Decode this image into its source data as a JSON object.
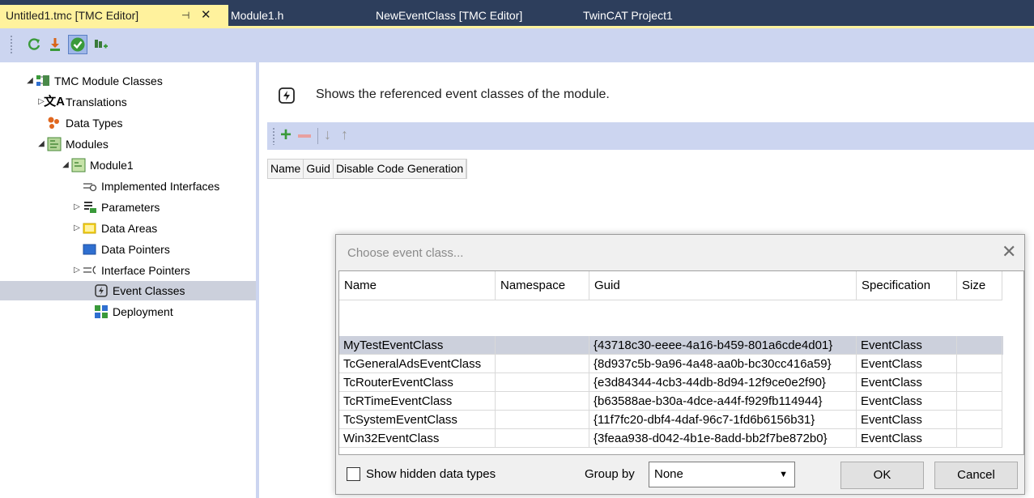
{
  "tabs": [
    {
      "label": "Untitled1.tmc [TMC Editor]",
      "active": true
    },
    {
      "label": "Module1.h"
    },
    {
      "label": "NewEventClass [TMC Editor]"
    },
    {
      "label": "TwinCAT Project1"
    }
  ],
  "tab_pin": "⊣",
  "tab_close": "✕",
  "toolbar_icons": [
    "refresh-icon",
    "download-icon",
    "check-icon",
    "plugin-icon"
  ],
  "tree": [
    {
      "label": "TMC Module Classes",
      "expander": "◢",
      "icon": "module-classes-icon"
    },
    {
      "label": "Translations",
      "expander": "▷",
      "icon": "translations-icon"
    },
    {
      "label": "Data Types",
      "expander": "",
      "icon": "data-types-icon"
    },
    {
      "label": "Modules",
      "expander": "◢",
      "icon": "modules-icon"
    },
    {
      "label": "Module1",
      "expander": "◢",
      "icon": "module-icon"
    },
    {
      "label": "Implemented Interfaces",
      "expander": "",
      "icon": "interfaces-icon"
    },
    {
      "label": "Parameters",
      "expander": "▷",
      "icon": "parameters-icon"
    },
    {
      "label": "Data Areas",
      "expander": "▷",
      "icon": "data-areas-icon"
    },
    {
      "label": "Data Pointers",
      "expander": "",
      "icon": "data-pointers-icon"
    },
    {
      "label": "Interface Pointers",
      "expander": "▷",
      "icon": "interface-pointers-icon"
    },
    {
      "label": "Event Classes",
      "expander": "",
      "icon": "event-classes-icon",
      "selected": true
    },
    {
      "label": "Deployment",
      "expander": "",
      "icon": "deployment-icon"
    }
  ],
  "description": "Shows the referenced event classes of the module.",
  "grid_columns": [
    "Name",
    "Guid",
    "Disable Code Generation"
  ],
  "dialog": {
    "title": "Choose event class...",
    "close": "✕",
    "columns": [
      "Name",
      "Namespace",
      "Guid",
      "Specification",
      "Size"
    ],
    "rows": [
      {
        "name": "MyTestEventClass",
        "namespace": "",
        "guid": "{43718c30-eeee-4a16-b459-801a6cde4d01}",
        "spec": "EventClass",
        "size": ""
      },
      {
        "name": "TcGeneralAdsEventClass",
        "namespace": "",
        "guid": "{8d937c5b-9a96-4a48-aa0b-bc30cc416a59}",
        "spec": "EventClass",
        "size": ""
      },
      {
        "name": "TcRouterEventClass",
        "namespace": "",
        "guid": "{e3d84344-4cb3-44db-8d94-12f9ce0e2f90}",
        "spec": "EventClass",
        "size": ""
      },
      {
        "name": "TcRTimeEventClass",
        "namespace": "",
        "guid": "{b63588ae-b30a-4dce-a44f-f929fb114944}",
        "spec": "EventClass",
        "size": ""
      },
      {
        "name": "TcSystemEventClass",
        "namespace": "",
        "guid": "{11f7fc20-dbf4-4daf-96c7-1fd6b6156b31}",
        "spec": "EventClass",
        "size": ""
      },
      {
        "name": "Win32EventClass",
        "namespace": "",
        "guid": "{3feaa938-d042-4b1e-8add-bb2f7be872b0}",
        "spec": "EventClass",
        "size": ""
      }
    ],
    "show_hidden_label": "Show hidden data types",
    "show_hidden_checked": false,
    "group_by_label": "Group by",
    "group_by_value": "None",
    "ok_label": "OK",
    "cancel_label": "Cancel"
  },
  "colors": {
    "tab_bar": "#2d3e5c",
    "active_tab": "#fff29d",
    "toolbar": "#ccd5f0",
    "selection": "#ccd0dc"
  }
}
